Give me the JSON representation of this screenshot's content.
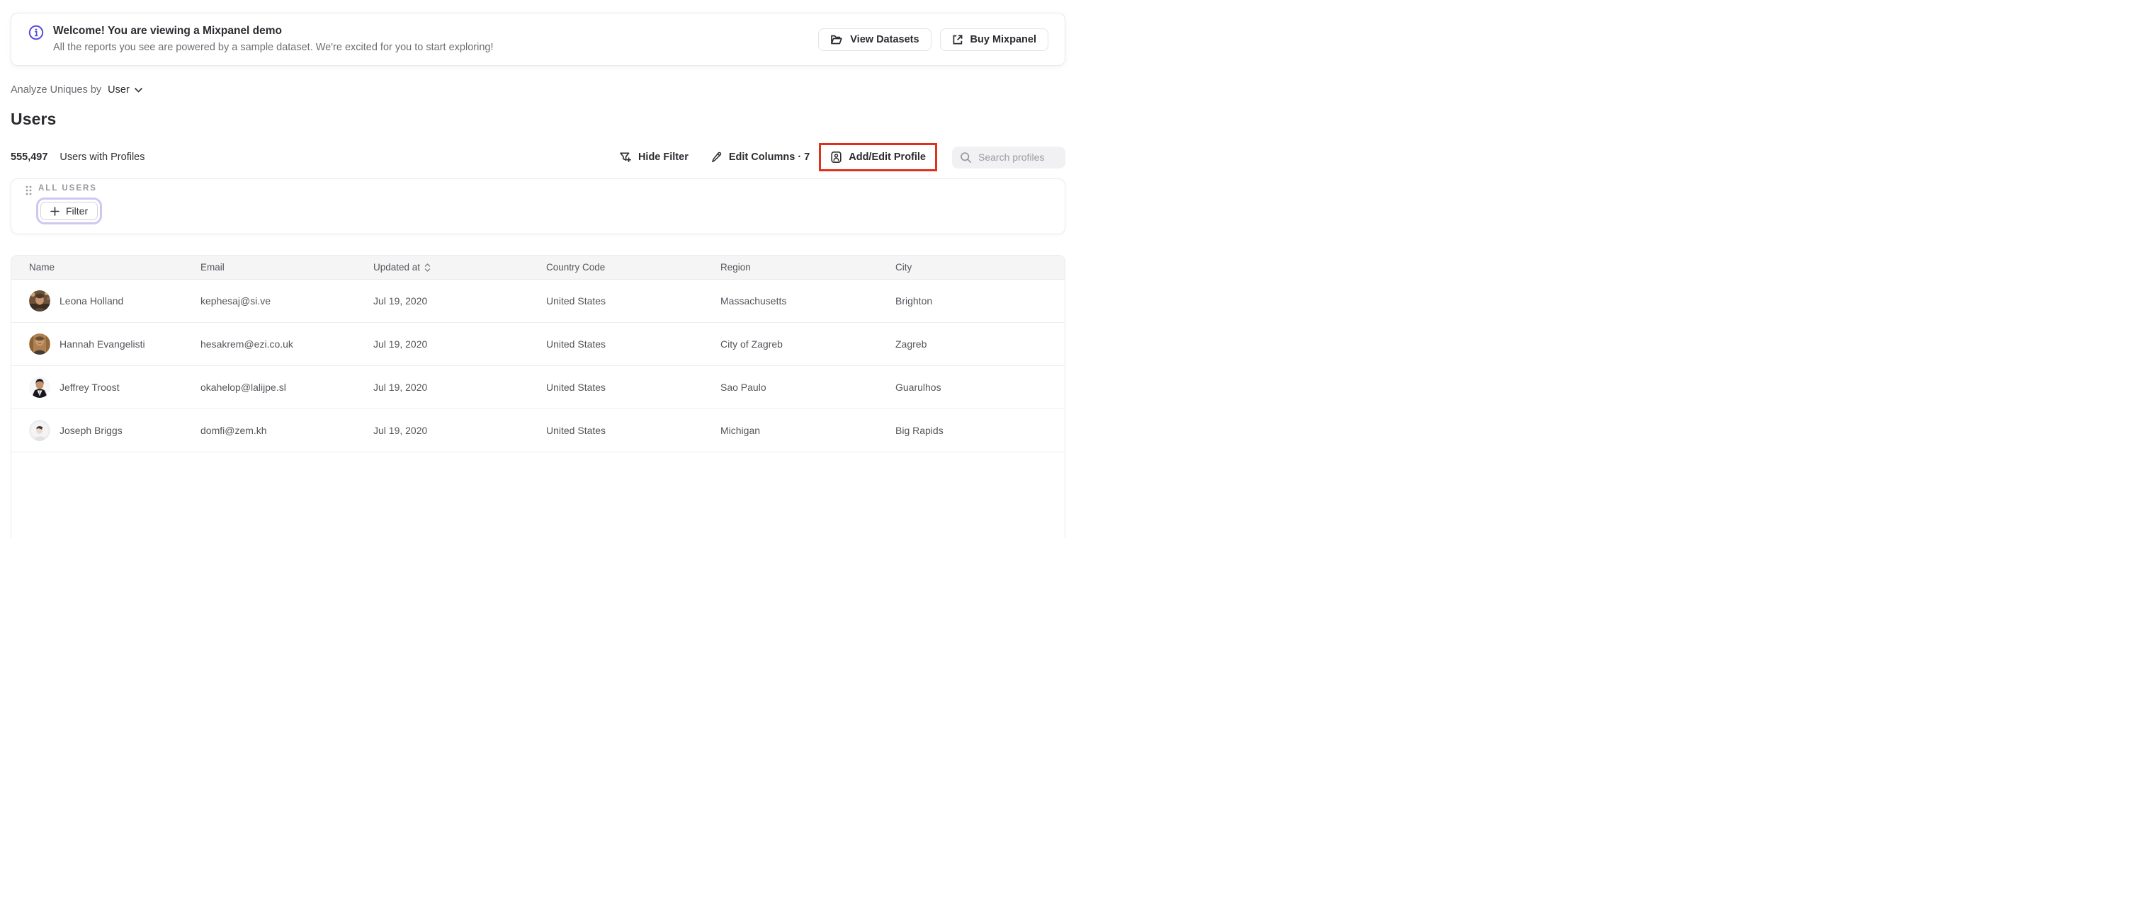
{
  "banner": {
    "title": "Welcome! You are viewing a Mixpanel demo",
    "subtitle": "All the reports you see are powered by a sample dataset. We're excited for you to start exploring!",
    "view_datasets_label": "View Datasets",
    "buy_mixpanel_label": "Buy Mixpanel"
  },
  "controls": {
    "analyze_label": "Analyze Uniques by",
    "analyze_value": "User"
  },
  "page": {
    "title": "Users"
  },
  "stats": {
    "count": "555,497",
    "label": "Users with Profiles"
  },
  "toolbar": {
    "hide_filter_label": "Hide Filter",
    "edit_columns_label": "Edit Columns · 7",
    "add_edit_profile_label": "Add/Edit Profile",
    "search_placeholder": "Search profiles"
  },
  "filter_panel": {
    "group_label": "ALL USERS",
    "add_filter_label": "Filter"
  },
  "table": {
    "columns": [
      "Name",
      "Email",
      "Updated at",
      "Country Code",
      "Region",
      "City"
    ],
    "rows": [
      {
        "name": "Leona Holland",
        "email": "kephesaj@si.ve",
        "updated_at": "Jul 19, 2020",
        "country": "United States",
        "region": "Massachusetts",
        "city": "Brighton"
      },
      {
        "name": "Hannah Evangelisti",
        "email": "hesakrem@ezi.co.uk",
        "updated_at": "Jul 19, 2020",
        "country": "United States",
        "region": "City of Zagreb",
        "city": "Zagreb"
      },
      {
        "name": "Jeffrey Troost",
        "email": "okahelop@lalijpe.sl",
        "updated_at": "Jul 19, 2020",
        "country": "United States",
        "region": "Sao Paulo",
        "city": "Guarulhos"
      },
      {
        "name": "Joseph Briggs",
        "email": "domfi@zem.kh",
        "updated_at": "Jul 19, 2020",
        "country": "United States",
        "region": "Michigan",
        "city": "Big Rapids"
      }
    ]
  },
  "colors": {
    "accent_purple": "#584ddb",
    "annotation_red": "#e1311a",
    "focus_ring": "#cdc8f3"
  }
}
